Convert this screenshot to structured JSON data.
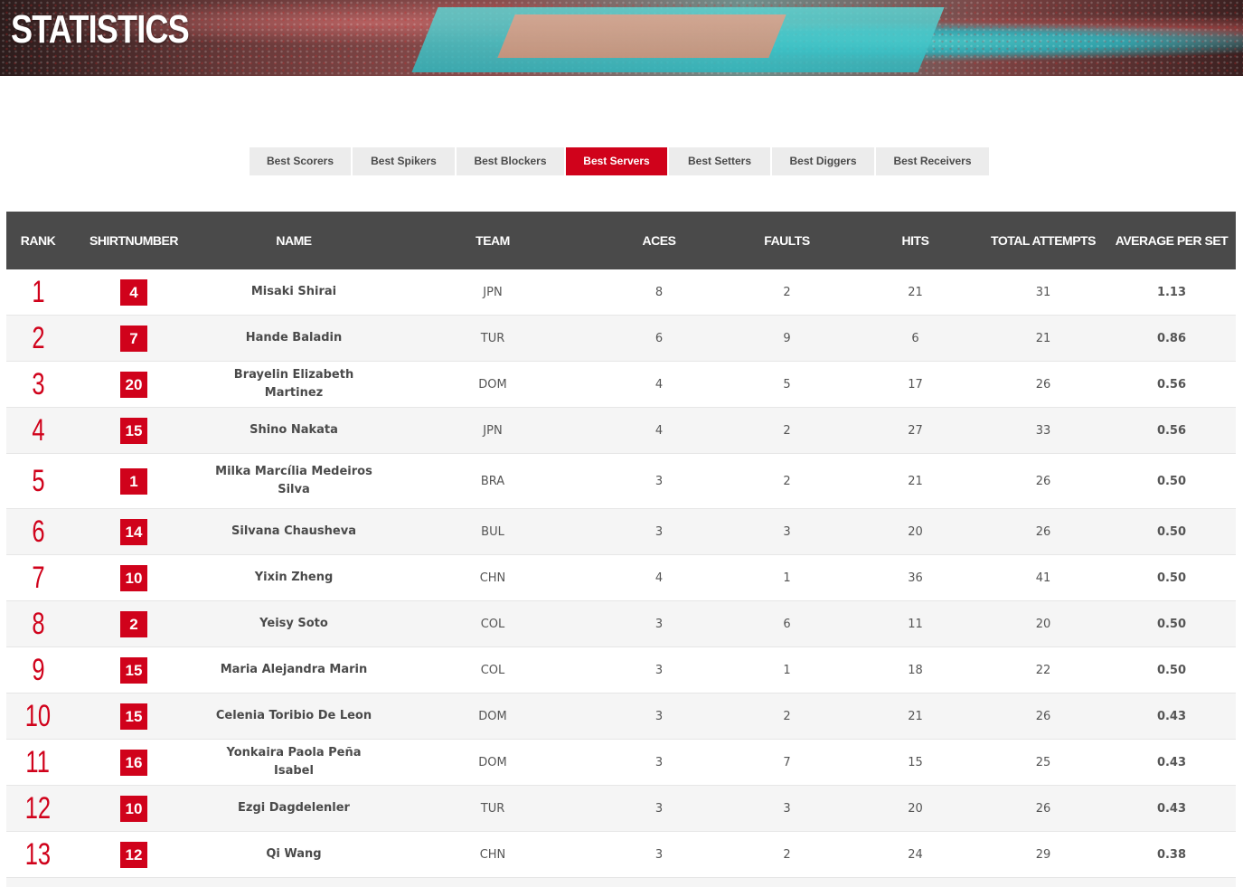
{
  "header": {
    "title": "STATISTICS"
  },
  "tabs": [
    {
      "label": "Best Scorers",
      "active": false
    },
    {
      "label": "Best Spikers",
      "active": false
    },
    {
      "label": "Best Blockers",
      "active": false
    },
    {
      "label": "Best Servers",
      "active": true
    },
    {
      "label": "Best Setters",
      "active": false
    },
    {
      "label": "Best Diggers",
      "active": false
    },
    {
      "label": "Best Receivers",
      "active": false
    }
  ],
  "table": {
    "columns": [
      "RANK",
      "SHIRTNUMBER",
      "NAME",
      "TEAM",
      "ACES",
      "FAULTS",
      "HITS",
      "TOTAL ATTEMPTS",
      "AVERAGE PER SET"
    ],
    "rows": [
      {
        "rank": "1",
        "shirt": "4",
        "name": "Misaki Shirai",
        "team": "JPN",
        "aces": "8",
        "faults": "2",
        "hits": "21",
        "total": "31",
        "avg": "1.13"
      },
      {
        "rank": "2",
        "shirt": "7",
        "name": "Hande Baladin",
        "team": "TUR",
        "aces": "6",
        "faults": "9",
        "hits": "6",
        "total": "21",
        "avg": "0.86"
      },
      {
        "rank": "3",
        "shirt": "20",
        "name": "Brayelin Elizabeth Martinez",
        "team": "DOM",
        "aces": "4",
        "faults": "5",
        "hits": "17",
        "total": "26",
        "avg": "0.56"
      },
      {
        "rank": "4",
        "shirt": "15",
        "name": "Shino Nakata",
        "team": "JPN",
        "aces": "4",
        "faults": "2",
        "hits": "27",
        "total": "33",
        "avg": "0.56"
      },
      {
        "rank": "5",
        "shirt": "1",
        "name": "Milka Marcília Medeiros Silva",
        "team": "BRA",
        "aces": "3",
        "faults": "2",
        "hits": "21",
        "total": "26",
        "avg": "0.50"
      },
      {
        "rank": "6",
        "shirt": "14",
        "name": "Silvana Chausheva",
        "team": "BUL",
        "aces": "3",
        "faults": "3",
        "hits": "20",
        "total": "26",
        "avg": "0.50"
      },
      {
        "rank": "7",
        "shirt": "10",
        "name": "Yixin Zheng",
        "team": "CHN",
        "aces": "4",
        "faults": "1",
        "hits": "36",
        "total": "41",
        "avg": "0.50"
      },
      {
        "rank": "8",
        "shirt": "2",
        "name": "Yeisy Soto",
        "team": "COL",
        "aces": "3",
        "faults": "6",
        "hits": "11",
        "total": "20",
        "avg": "0.50"
      },
      {
        "rank": "9",
        "shirt": "15",
        "name": "Maria Alejandra Marin",
        "team": "COL",
        "aces": "3",
        "faults": "1",
        "hits": "18",
        "total": "22",
        "avg": "0.50"
      },
      {
        "rank": "10",
        "shirt": "15",
        "name": "Celenia Toribio De Leon",
        "team": "DOM",
        "aces": "3",
        "faults": "2",
        "hits": "21",
        "total": "26",
        "avg": "0.43"
      },
      {
        "rank": "11",
        "shirt": "16",
        "name": "Yonkaira Paola Peña Isabel",
        "team": "DOM",
        "aces": "3",
        "faults": "7",
        "hits": "15",
        "total": "25",
        "avg": "0.43"
      },
      {
        "rank": "12",
        "shirt": "10",
        "name": "Ezgi Dagdelenler",
        "team": "TUR",
        "aces": "3",
        "faults": "3",
        "hits": "20",
        "total": "26",
        "avg": "0.43"
      },
      {
        "rank": "13",
        "shirt": "12",
        "name": "Qi Wang",
        "team": "CHN",
        "aces": "3",
        "faults": "2",
        "hits": "24",
        "total": "29",
        "avg": "0.38"
      }
    ]
  },
  "colors": {
    "accent": "#d0021b",
    "header_bg": "#4a4a4a",
    "tab_bg": "#ececec"
  }
}
